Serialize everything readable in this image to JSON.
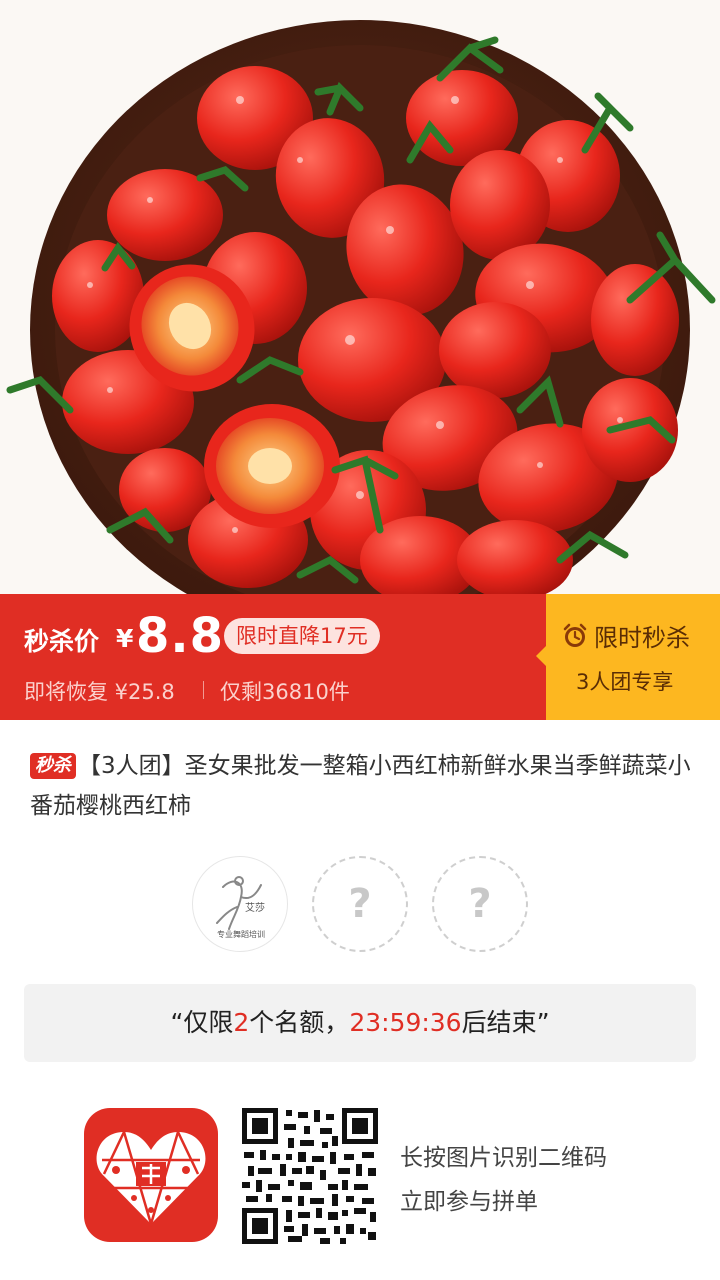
{
  "price": {
    "label": "秒杀价",
    "currency": "¥",
    "value": "8.8",
    "discount": "限时直降17元",
    "restore": "即将恢复 ¥25.8",
    "remaining": "仅剩36810件"
  },
  "flash": {
    "title": "限时秒杀",
    "subtitle": "3人团专享"
  },
  "product": {
    "badge": "秒杀",
    "title": "【3人团】圣女果批发一整箱小西红柿新鲜水果当季鲜蔬菜小番茄樱桃西红柿"
  },
  "members": {
    "avatar_text_main": "艾莎",
    "avatar_text_sub": "专业舞蹈培训",
    "empty_mark": "?"
  },
  "quota": {
    "prefix": "“仅限",
    "count": "2",
    "middle": "个名额，",
    "time": "23:59:36",
    "suffix": "后结束”"
  },
  "footer": {
    "line1": "长按图片识别二维码",
    "line2": "立即参与拼单"
  },
  "colors": {
    "brand_red": "#e02e24",
    "flash_yellow": "#fdb720"
  }
}
